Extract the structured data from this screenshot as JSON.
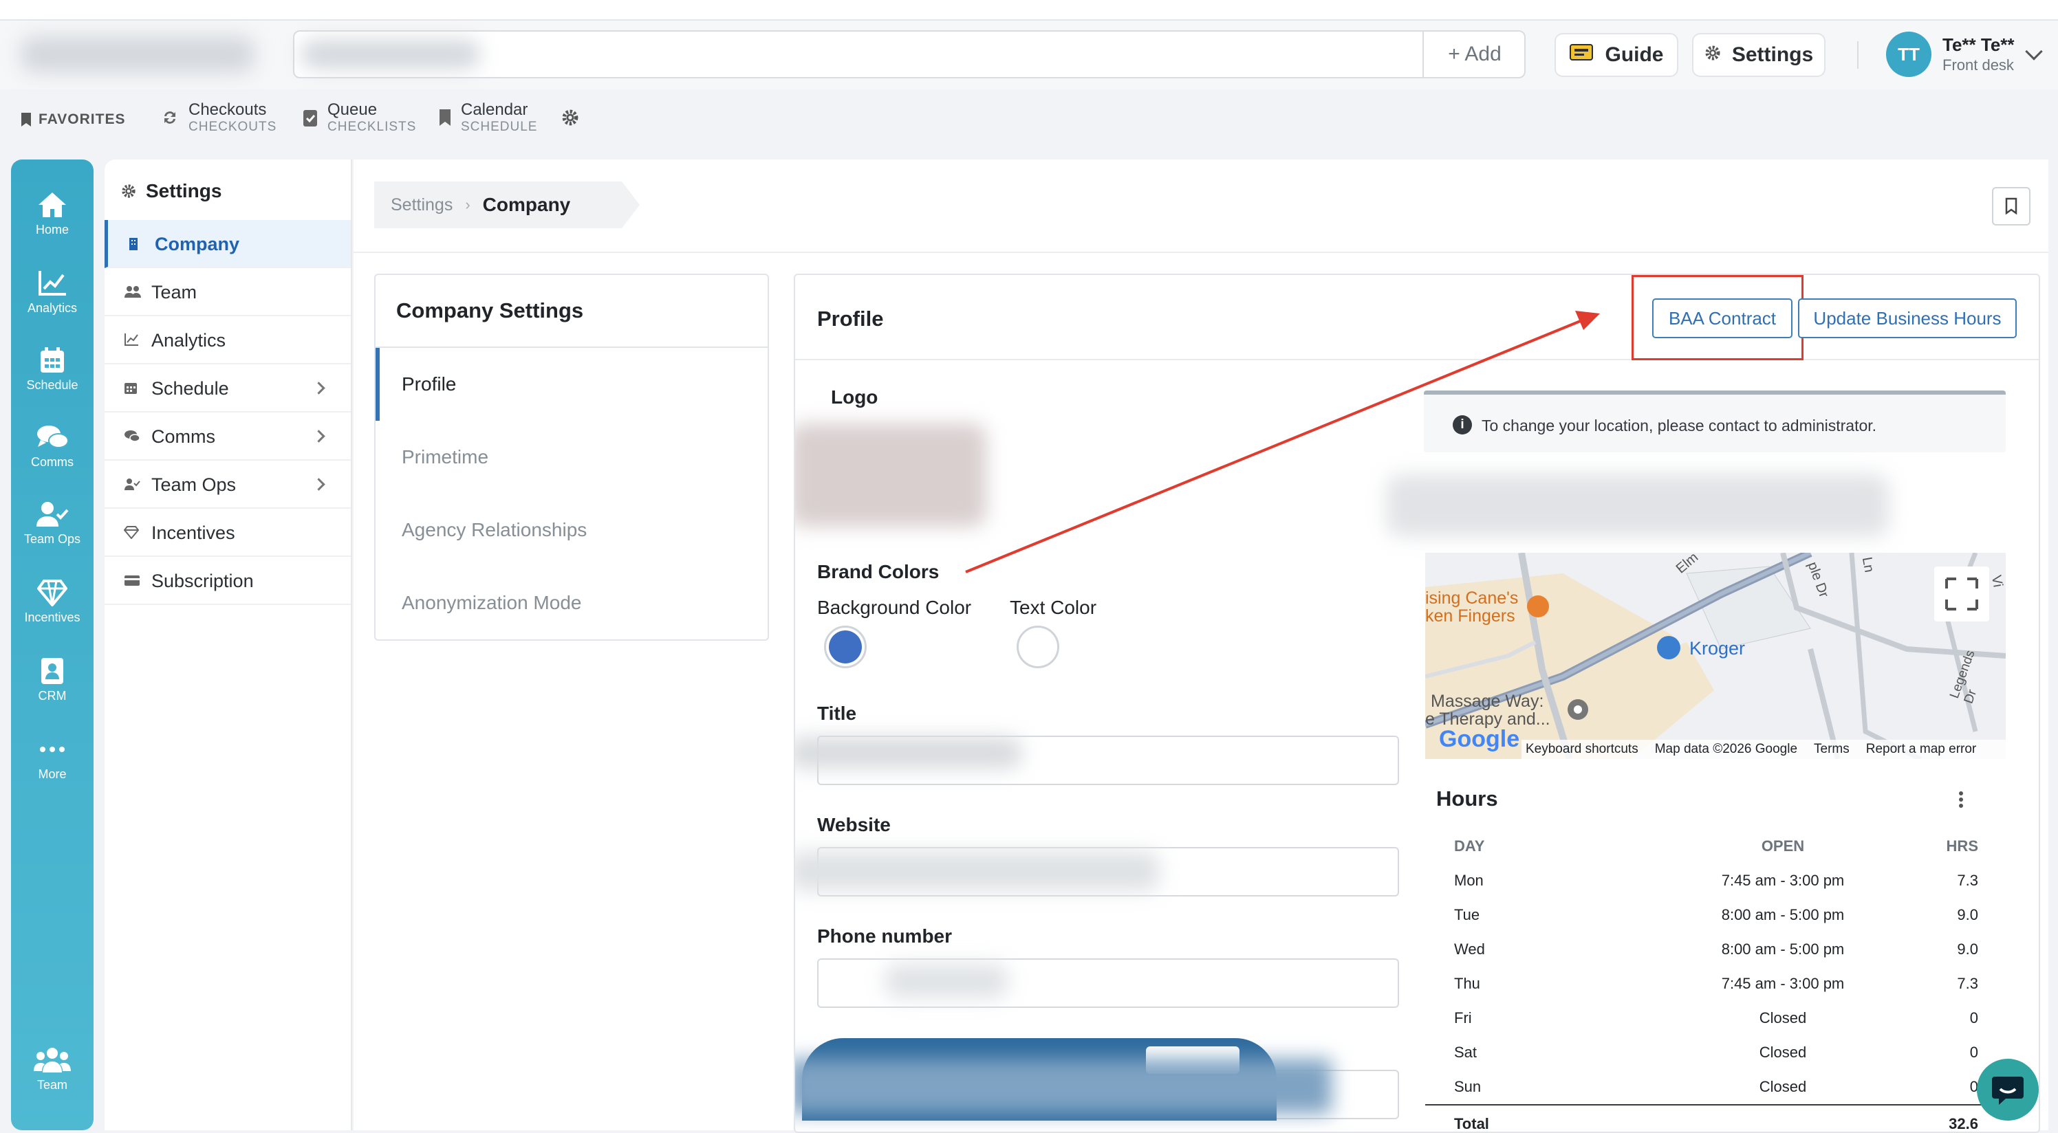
{
  "topbar": {
    "add_label": "+ Add",
    "guide_label": "Guide",
    "settings_label": "Settings",
    "user": {
      "initials": "TT",
      "name": "Te** Te**",
      "role": "Front desk"
    }
  },
  "favorites": {
    "title": "FAVORITES",
    "items": [
      {
        "title": "Checkouts",
        "sub": "CHECKOUTS"
      },
      {
        "title": "Queue",
        "sub": "CHECKLISTS"
      },
      {
        "title": "Calendar",
        "sub": "SCHEDULE"
      }
    ]
  },
  "rail": {
    "items": [
      "Home",
      "Analytics",
      "Schedule",
      "Comms",
      "Team Ops",
      "Incentives",
      "CRM",
      "More"
    ],
    "bottom": "Team"
  },
  "settings_nav": {
    "header": "Settings",
    "items": [
      "Company",
      "Team",
      "Analytics",
      "Schedule",
      "Comms",
      "Team Ops",
      "Incentives",
      "Subscription"
    ]
  },
  "breadcrumb": {
    "root": "Settings",
    "current": "Company"
  },
  "company_settings": {
    "title": "Company Settings",
    "items": [
      "Profile",
      "Primetime",
      "Agency Relationships",
      "Anonymization Mode"
    ]
  },
  "profile": {
    "title": "Profile",
    "baa_label": "BAA Contract",
    "hours_label": "Update Business Hours",
    "logo_label": "Logo",
    "brand_colors_label": "Brand Colors",
    "bg_color_label": "Background Color",
    "text_color_label": "Text Color",
    "bg_color": "#3e6fc2",
    "text_color": "#ffffff",
    "title_label": "Title",
    "website_label": "Website",
    "phone_label": "Phone number"
  },
  "info_message": "To change your location, please contact to administrator.",
  "map": {
    "places": [
      "ising Cane's",
      "ken Fingers",
      "Kroger",
      "Massage Way:",
      "e Therapy and..."
    ],
    "roads": [
      "Elm",
      "ple Dr",
      "Ln",
      "Legends Dr",
      "Vi"
    ],
    "google": "Google",
    "footer": [
      "Keyboard shortcuts",
      "Map data ©2026 Google",
      "Terms",
      "Report a map error"
    ]
  },
  "hours": {
    "title": "Hours",
    "headers": [
      "DAY",
      "OPEN",
      "HRS"
    ],
    "rows": [
      {
        "day": "Mon",
        "open": "7:45 am - 3:00 pm",
        "hrs": "7.3"
      },
      {
        "day": "Tue",
        "open": "8:00 am - 5:00 pm",
        "hrs": "9.0"
      },
      {
        "day": "Wed",
        "open": "8:00 am - 5:00 pm",
        "hrs": "9.0"
      },
      {
        "day": "Thu",
        "open": "7:45 am - 3:00 pm",
        "hrs": "7.3"
      },
      {
        "day": "Fri",
        "open": "Closed",
        "hrs": "0"
      },
      {
        "day": "Sat",
        "open": "Closed",
        "hrs": "0"
      },
      {
        "day": "Sun",
        "open": "Closed",
        "hrs": "0"
      }
    ],
    "total_label": "Total",
    "total_value": "32.6"
  },
  "colors": {
    "accent": "#2f6fb3",
    "rail": "#3aa9c7",
    "annotation": "#e03b2f"
  }
}
